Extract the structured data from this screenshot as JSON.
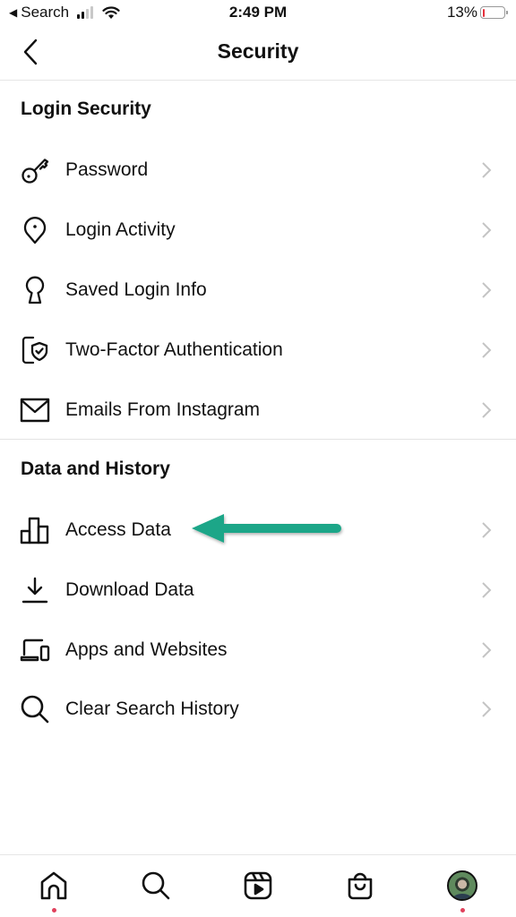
{
  "status_bar": {
    "back_app": "Search",
    "time": "2:49 PM",
    "battery_percent": "13%",
    "battery_level": 0.13,
    "signal_bars_active": 2,
    "signal_bars_total": 4
  },
  "header": {
    "back_icon": "chevron-left-icon",
    "title": "Security"
  },
  "sections": [
    {
      "title": "Login Security",
      "items": [
        {
          "label": "Password",
          "icon": "key-icon"
        },
        {
          "label": "Login Activity",
          "icon": "location-pin-icon"
        },
        {
          "label": "Saved Login Info",
          "icon": "keyhole-icon"
        },
        {
          "label": "Two-Factor Authentication",
          "icon": "phone-shield-icon"
        },
        {
          "label": "Emails From Instagram",
          "icon": "envelope-icon"
        }
      ]
    },
    {
      "title": "Data and History",
      "items": [
        {
          "label": "Access Data",
          "icon": "bar-chart-icon"
        },
        {
          "label": "Download Data",
          "icon": "download-icon"
        },
        {
          "label": "Apps and Websites",
          "icon": "laptop-phone-icon"
        },
        {
          "label": "Clear Search History",
          "icon": "search-icon"
        }
      ]
    }
  ],
  "annotation": {
    "type": "arrow",
    "points_to": "Access Data",
    "color": "#1fa688"
  },
  "bottom_nav": {
    "items": [
      {
        "name": "home",
        "icon": "home-icon",
        "notification_dot": true
      },
      {
        "name": "search",
        "icon": "search-icon",
        "notification_dot": false
      },
      {
        "name": "reels",
        "icon": "reels-icon",
        "notification_dot": false
      },
      {
        "name": "shop",
        "icon": "shopping-bag-icon",
        "notification_dot": false
      },
      {
        "name": "profile",
        "icon": "avatar",
        "notification_dot": true
      }
    ],
    "dot_color": "#e0415c"
  }
}
